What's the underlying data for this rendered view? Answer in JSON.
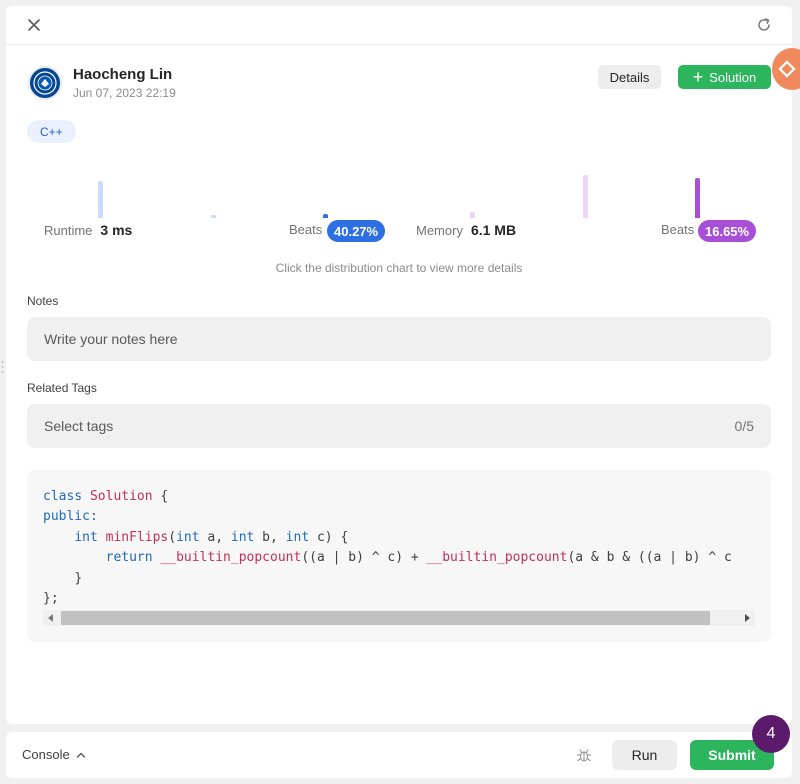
{
  "user": {
    "name": "Haocheng Lin",
    "date": "Jun 07, 2023 22:19"
  },
  "actions": {
    "details_label": "Details",
    "solution_label": "Solution"
  },
  "language": "C++",
  "runtime": {
    "label": "Runtime",
    "value": "3 ms",
    "beats_label": "Beats",
    "beats_value": "40.27%"
  },
  "memory": {
    "label": "Memory",
    "value": "6.1 MB",
    "beats_label": "Beats",
    "beats_value": "16.65%"
  },
  "chart_hint": "Click the distribution chart to view more details",
  "notes": {
    "label": "Notes",
    "placeholder": "Write your notes here"
  },
  "tags": {
    "label": "Related Tags",
    "placeholder": "Select tags",
    "count": "0/5"
  },
  "code": {
    "line1_kw": "class",
    "line1_cls": "Solution",
    "line1_rest": " {",
    "line2": "public:",
    "line3_t1": "int",
    "line3_fn": "minFlips",
    "line3_p1": "(",
    "line3_t2": "int",
    "line3_a": " a, ",
    "line3_t3": "int",
    "line3_b": " b, ",
    "line3_t4": "int",
    "line3_c": " c) {",
    "line4_kw": "return",
    "line4_f1": "__builtin_popcount",
    "line4_m1": "((a | b) ^ c) + ",
    "line4_f2": "__builtin_popcount",
    "line4_m2": "(a & b & ((a | b) ^ c",
    "line5": "}",
    "line6": "};"
  },
  "bottom": {
    "console_label": "Console",
    "run_label": "Run",
    "submit_label": "Submit"
  },
  "notification_count": "4",
  "colors": {
    "accent_green": "#2db55d",
    "runtime_blue": "#2f6fe4",
    "memory_purple": "#a84fd8"
  }
}
